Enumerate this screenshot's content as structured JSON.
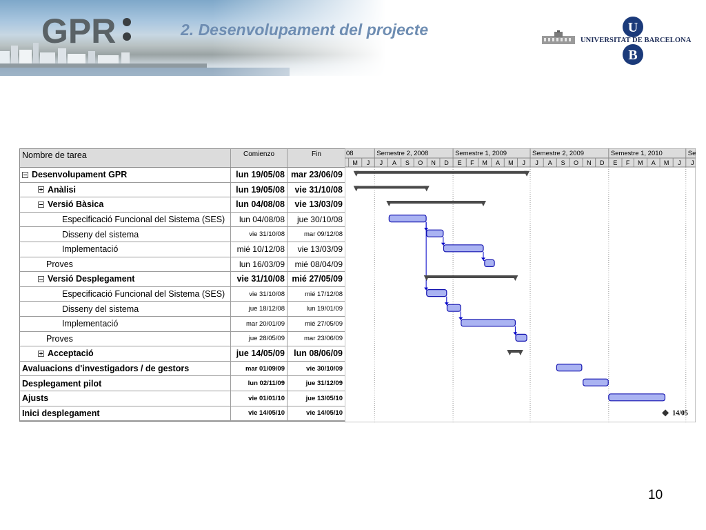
{
  "header": {
    "title": "2. Desenvolupament del projecte",
    "logo_text": "GPR",
    "university": "UNIVERSITAT DE BARCELONA",
    "emblem_letters": [
      "U",
      "B"
    ]
  },
  "page_number": "10",
  "colors": {
    "title": "#6e8db2",
    "summary_bar": "#4a4a4a",
    "task_bar_fill": "#aab3f2",
    "task_bar_border": "#1515b0",
    "link_arrow": "#0000c8",
    "grid_dotted": "#9b9b9b"
  },
  "table": {
    "columns": [
      "Nombre de tarea",
      "Comienzo",
      "Fin"
    ],
    "rows": [
      {
        "name": "Desenvolupament GPR",
        "start": "lun 19/05/08",
        "end": "mar 23/06/09",
        "level": 0,
        "outline": "minus",
        "bold": true,
        "size": "bold"
      },
      {
        "name": "Anàlisi",
        "start": "lun 19/05/08",
        "end": "vie 31/10/08",
        "level": 1,
        "outline": "plus",
        "bold": true,
        "size": "bold"
      },
      {
        "name": "Versió Bàsica",
        "start": "lun 04/08/08",
        "end": "vie 13/03/09",
        "level": 1,
        "outline": "minus",
        "bold": true,
        "size": "bold"
      },
      {
        "name": "Especificació Funcional del Sistema (SES)",
        "start": "lun 04/08/08",
        "end": "jue 30/10/08",
        "level": 3,
        "outline": "",
        "bold": false,
        "size": "reg"
      },
      {
        "name": "Disseny del sistema",
        "start": "vie 31/10/08",
        "end": "mar 09/12/08",
        "level": 3,
        "outline": "",
        "bold": false,
        "size": "small"
      },
      {
        "name": "Implementació",
        "start": "mié 10/12/08",
        "end": "vie 13/03/09",
        "level": 3,
        "outline": "",
        "bold": false,
        "size": "reg"
      },
      {
        "name": "Proves",
        "start": "lun 16/03/09",
        "end": "mié 08/04/09",
        "level": 2,
        "outline": "",
        "bold": false,
        "size": "reg"
      },
      {
        "name": "Versió Desplegament",
        "start": "vie 31/10/08",
        "end": "mié 27/05/09",
        "level": 1,
        "outline": "minus",
        "bold": true,
        "size": "bold"
      },
      {
        "name": "Especificació Funcional del Sistema (SES)",
        "start": "vie 31/10/08",
        "end": "mié 17/12/08",
        "level": 3,
        "outline": "",
        "bold": false,
        "size": "small"
      },
      {
        "name": "Disseny del sistema",
        "start": "jue 18/12/08",
        "end": "lun 19/01/09",
        "level": 3,
        "outline": "",
        "bold": false,
        "size": "small"
      },
      {
        "name": "Implementació",
        "start": "mar 20/01/09",
        "end": "mié 27/05/09",
        "level": 3,
        "outline": "",
        "bold": false,
        "size": "small"
      },
      {
        "name": "Proves",
        "start": "jue 28/05/09",
        "end": "mar 23/06/09",
        "level": 2,
        "outline": "",
        "bold": false,
        "size": "small"
      },
      {
        "name": "Acceptació",
        "start": "jue 14/05/09",
        "end": "lun 08/06/09",
        "level": 1,
        "outline": "plus",
        "bold": true,
        "size": "bold"
      },
      {
        "name": "Avaluacions d'investigadors / de gestors",
        "start": "mar 01/09/09",
        "end": "vie 30/10/09",
        "level": 0,
        "outline": "",
        "bold": true,
        "size": "small"
      },
      {
        "name": "Desplegament pilot",
        "start": "lun 02/11/09",
        "end": "jue 31/12/09",
        "level": 0,
        "outline": "",
        "bold": true,
        "size": "small"
      },
      {
        "name": "Ajusts",
        "start": "vie 01/01/10",
        "end": "jue 13/05/10",
        "level": 0,
        "outline": "",
        "bold": true,
        "size": "small"
      },
      {
        "name": "Inici desplegament",
        "start": "vie 14/05/10",
        "end": "vie 14/05/10",
        "level": 0,
        "outline": "",
        "bold": true,
        "size": "small"
      }
    ]
  },
  "chart_data": {
    "type": "gantt",
    "timescale_top": [
      "08",
      "Semestre 2, 2008",
      "Semestre 1, 2009",
      "Semestre 2, 2009",
      "Semestre 1, 2010",
      "Se"
    ],
    "timescale_bottom": [
      "M",
      "J",
      "J",
      "A",
      "S",
      "O",
      "N",
      "D",
      "E",
      "F",
      "M",
      "A",
      "M",
      "J",
      "J",
      "A",
      "S",
      "O",
      "N",
      "D",
      "E",
      "F",
      "M",
      "A",
      "M",
      "J",
      "J"
    ],
    "x_range": [
      "2008-04-22",
      "2010-07-24"
    ],
    "tasks": [
      {
        "start": "2008-05-19",
        "end": "2009-06-23",
        "kind": "summary"
      },
      {
        "start": "2008-05-19",
        "end": "2008-10-31",
        "kind": "summary"
      },
      {
        "start": "2008-08-04",
        "end": "2009-03-13",
        "kind": "summary"
      },
      {
        "start": "2008-08-04",
        "end": "2008-10-30",
        "kind": "task"
      },
      {
        "start": "2008-10-31",
        "end": "2008-12-09",
        "kind": "task"
      },
      {
        "start": "2008-12-10",
        "end": "2009-03-13",
        "kind": "task"
      },
      {
        "start": "2009-03-16",
        "end": "2009-04-08",
        "kind": "task"
      },
      {
        "start": "2008-10-31",
        "end": "2009-05-27",
        "kind": "summary"
      },
      {
        "start": "2008-10-31",
        "end": "2008-12-17",
        "kind": "task"
      },
      {
        "start": "2008-12-18",
        "end": "2009-01-19",
        "kind": "task"
      },
      {
        "start": "2009-01-20",
        "end": "2009-05-27",
        "kind": "task"
      },
      {
        "start": "2009-05-28",
        "end": "2009-06-23",
        "kind": "task"
      },
      {
        "start": "2009-05-14",
        "end": "2009-06-08",
        "kind": "summary"
      },
      {
        "start": "2009-09-01",
        "end": "2009-10-30",
        "kind": "task"
      },
      {
        "start": "2009-11-02",
        "end": "2009-12-31",
        "kind": "task"
      },
      {
        "start": "2010-01-01",
        "end": "2010-05-13",
        "kind": "task"
      },
      {
        "start": "2010-05-14",
        "end": "2010-05-14",
        "kind": "milestone",
        "label": "14/05"
      }
    ],
    "links": [
      [
        3,
        4
      ],
      [
        4,
        5
      ],
      [
        5,
        6
      ],
      [
        3,
        8
      ],
      [
        8,
        9
      ],
      [
        9,
        10
      ],
      [
        10,
        11
      ]
    ]
  }
}
